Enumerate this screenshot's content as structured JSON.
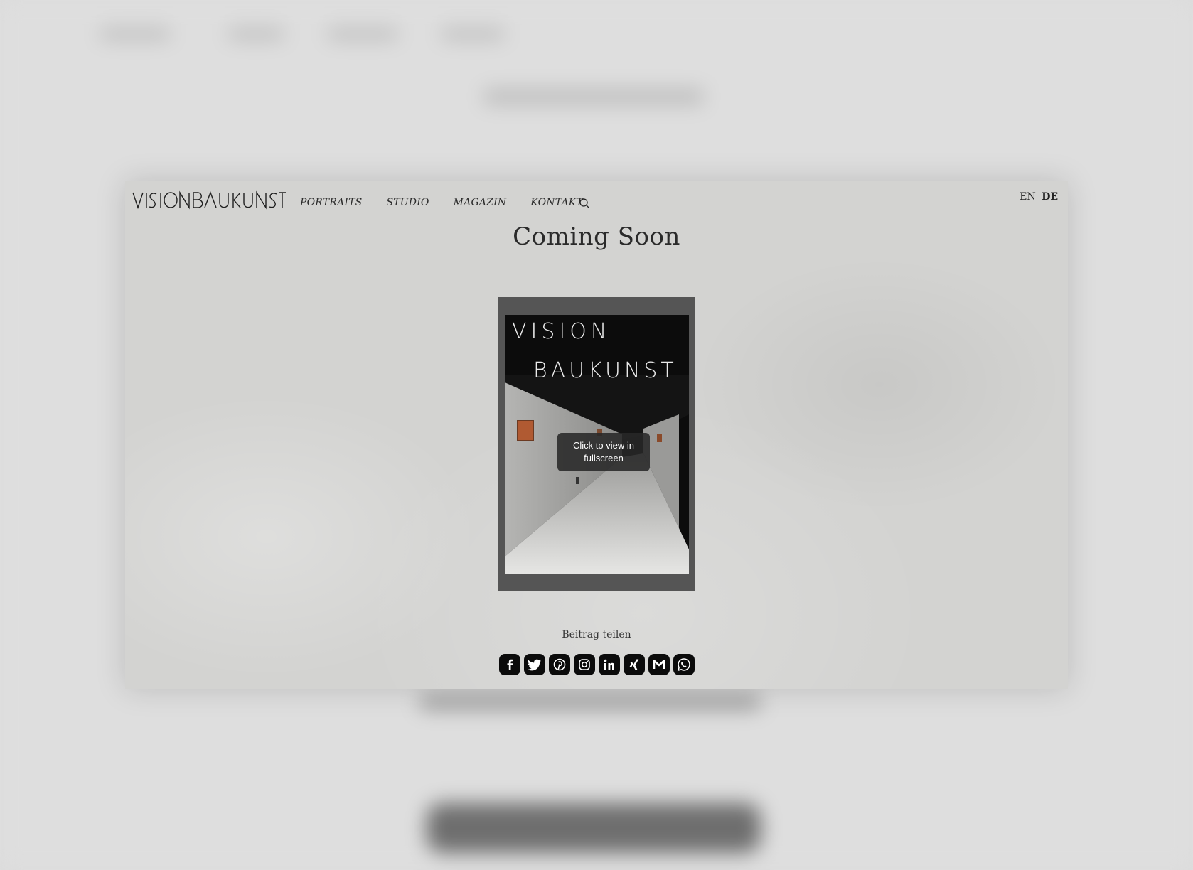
{
  "header": {
    "logo_text": "VISIONBAUKUNST",
    "nav": [
      "PORTRAITS",
      "STUDIO",
      "MAGAZIN",
      "KONTAKT"
    ],
    "search_icon": "search-icon",
    "lang": [
      "EN",
      "DE"
    ],
    "active_lang": "DE"
  },
  "main": {
    "title": "Coming Soon",
    "viewer": {
      "cover_line1": "VISION",
      "cover_line2": "BAUKUNST",
      "tooltip": "Click to view in fullscreen"
    },
    "share_label": "Beitrag teilen",
    "share_icons": [
      "facebook-icon",
      "twitter-icon",
      "pinterest-icon",
      "instagram-icon",
      "linkedin-icon",
      "xing-icon",
      "email-icon",
      "whatsapp-icon"
    ]
  },
  "colors": {
    "page_bg": "#d3d3d1",
    "viewer_bg": "#555555",
    "share_bg": "#0b0b0b"
  }
}
